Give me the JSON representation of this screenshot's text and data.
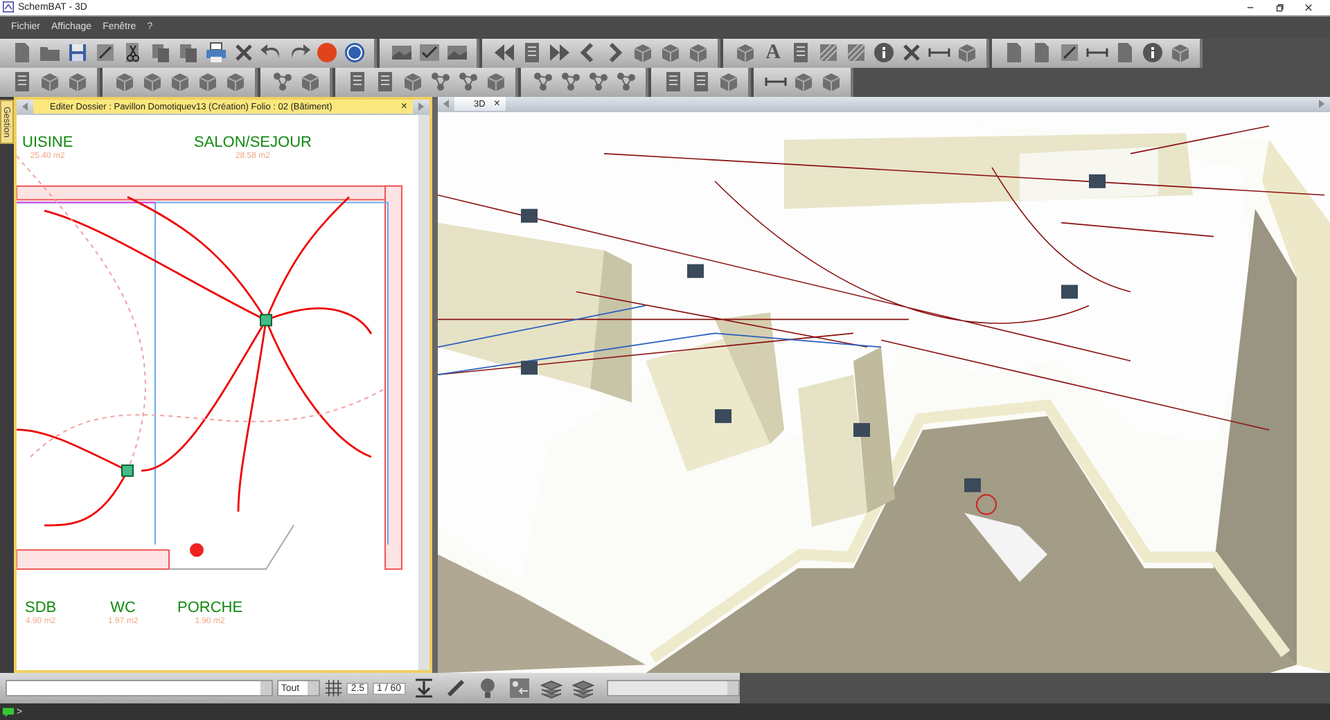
{
  "window": {
    "title": "SchemBAT - 3D"
  },
  "menu": [
    "Fichier",
    "Affichage",
    "Fenêtre",
    "?"
  ],
  "toolbar": {
    "text_tool_glyph": "A"
  },
  "side_tab": {
    "label": "Gestion"
  },
  "left_pane": {
    "tab": {
      "label": "Editer  Dossier : Pavillon Domotiquev13  (Création)  Folio : 02  (Bâtiment)",
      "close": "×",
      "focused": true
    }
  },
  "right_pane": {
    "tab": {
      "label": "3D",
      "close": "×",
      "focused": false
    }
  },
  "plan": {
    "rooms": [
      {
        "name": "UISINE",
        "area": "25.40 m2"
      },
      {
        "name": "SALON/SEJOUR",
        "area": "28.58 m2"
      },
      {
        "name": "SDB",
        "area": "4.90 m2"
      },
      {
        "name": "WC",
        "area": "1.97 m2"
      },
      {
        "name": "PORCHE",
        "area": "1.90 m2"
      }
    ]
  },
  "bottom_bar": {
    "layer_filter": "Tout",
    "grid_step": "2.5",
    "scale": "1 / 60"
  },
  "status_bar": {
    "prompt": ">"
  }
}
